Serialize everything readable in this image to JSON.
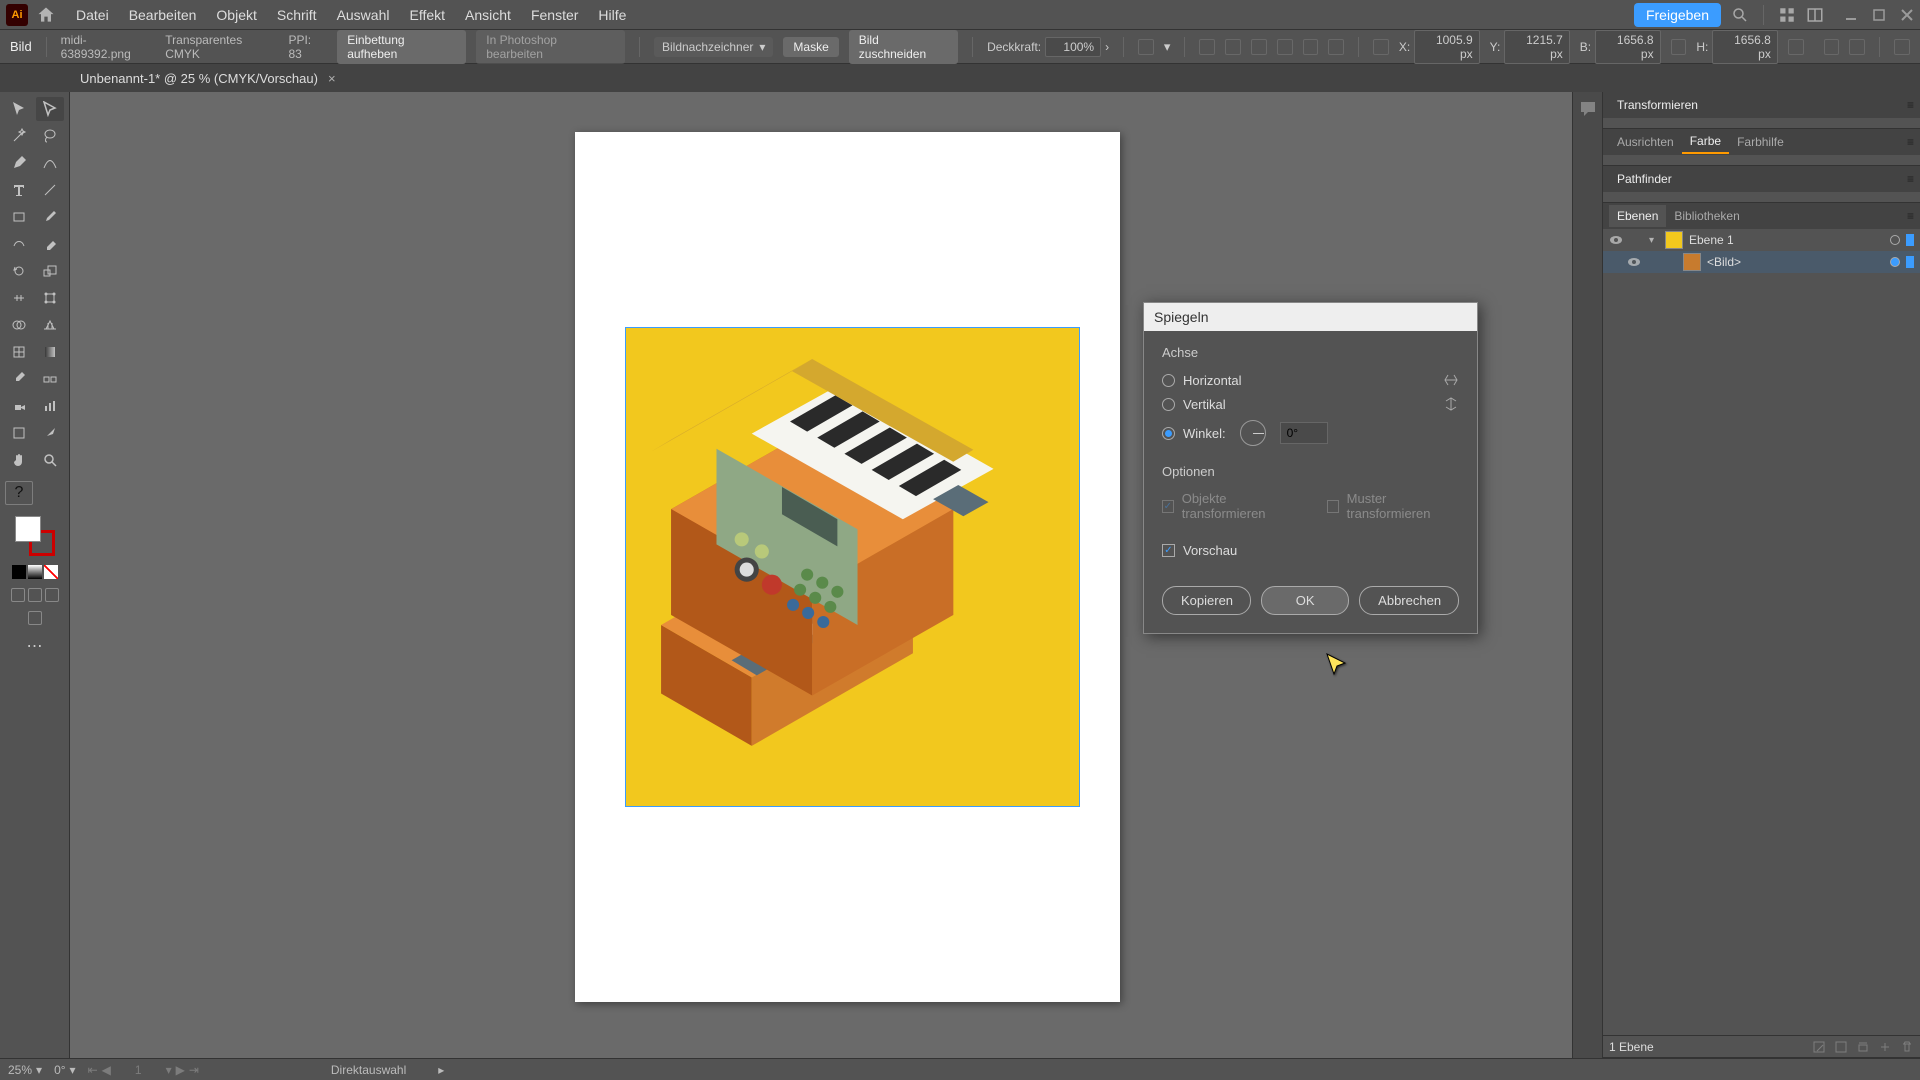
{
  "app": {
    "logo_text": "Ai"
  },
  "menu": [
    "Datei",
    "Bearbeiten",
    "Objekt",
    "Schrift",
    "Auswahl",
    "Effekt",
    "Ansicht",
    "Fenster",
    "Hilfe"
  ],
  "share_label": "Freigeben",
  "controlbar": {
    "type": "Bild",
    "filename": "midi-6389392.png",
    "colormode": "Transparentes CMYK",
    "ppi": "PPI: 83",
    "unembed": "Einbettung aufheben",
    "editps": "In Photoshop bearbeiten",
    "tracer": "Bildnachzeichner",
    "mask": "Maske",
    "crop": "Bild zuschneiden",
    "opacity_label": "Deckkraft:",
    "opacity_val": "100%",
    "x_label": "X:",
    "x_val": "1005.9 px",
    "y_label": "Y:",
    "y_val": "1215.7 px",
    "w_label": "B:",
    "w_val": "1656.8 px",
    "h_label": "H:",
    "h_val": "1656.8 px"
  },
  "doc_tab": {
    "title": "Unbenannt-1* @ 25 % (CMYK/Vorschau)"
  },
  "dialog": {
    "title": "Spiegeln",
    "axis_heading": "Achse",
    "horiz": "Horizontal",
    "vert": "Vertikal",
    "angle_label": "Winkel:",
    "angle_val": "0°",
    "options_heading": "Optionen",
    "transform_obj": "Objekte transformieren",
    "transform_pat": "Muster transformieren",
    "preview": "Vorschau",
    "copy": "Kopieren",
    "ok": "OK",
    "cancel": "Abbrechen"
  },
  "panels": {
    "transform": "Transformieren",
    "align": "Ausrichten",
    "color": "Farbe",
    "guides": "Farbhilfe",
    "pathfinder": "Pathfinder",
    "layers": "Ebenen",
    "libraries": "Bibliotheken",
    "layer1": "Ebene 1",
    "img_item": "<Bild>",
    "layer_count": "1 Ebene"
  },
  "status": {
    "zoom": "25%",
    "rotate": "0°",
    "artboard": "1",
    "tool": "Direktauswahl"
  }
}
